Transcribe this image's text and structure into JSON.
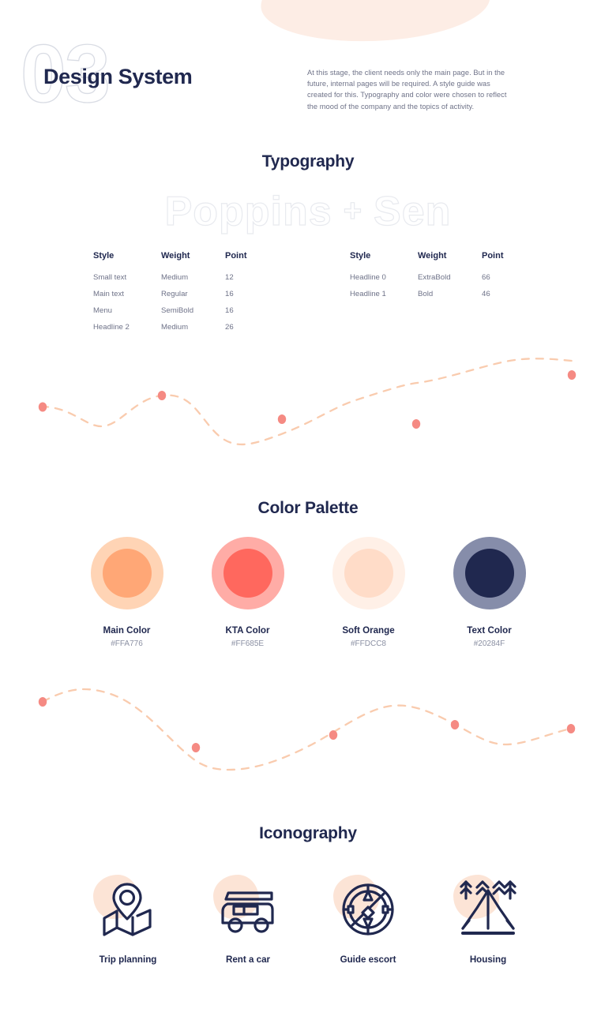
{
  "header": {
    "numeral": "03",
    "title": "Design System",
    "intro": "At this stage, the client needs only the main page. But in the future, internal pages will be required. A style guide was created for this.  Typography and color were chosen to reflect the mood of the company and the topics of activity."
  },
  "sections": {
    "typography": "Typography",
    "palette": "Color Palette",
    "iconography": "Iconography"
  },
  "typography": {
    "font_primary": "Poppins",
    "font_plus": "+",
    "font_secondary": "Sen",
    "columns": [
      "Style",
      "Weight",
      "Point"
    ],
    "left_rows": [
      {
        "style": "Small text",
        "weight": "Medium",
        "point": "12"
      },
      {
        "style": "Main text",
        "weight": "Regular",
        "point": "16"
      },
      {
        "style": "Menu",
        "weight": "SemiBold",
        "point": "16"
      },
      {
        "style": "Headline 2",
        "weight": "Medium",
        "point": "26"
      }
    ],
    "right_rows": [
      {
        "style": "Headline 0",
        "weight": "ExtraBold",
        "point": "66"
      },
      {
        "style": "Headline 1",
        "weight": "Bold",
        "point": "46"
      }
    ]
  },
  "palette": {
    "swatches": [
      {
        "name": "Main Color",
        "hex": "#FFA776",
        "ring": "#FFD4B5"
      },
      {
        "name": "KTA Color",
        "hex": "#FF685E",
        "ring": "#FFACA6"
      },
      {
        "name": "Soft Orange",
        "hex": "#FFDCC8",
        "ring": "#FFF0E7"
      },
      {
        "name": "Text Color",
        "hex": "#20284F",
        "ring": "#868DAA"
      }
    ]
  },
  "iconography": {
    "items": [
      {
        "label": "Trip planning",
        "icon": "map-pin-icon"
      },
      {
        "label": "Rent a car",
        "icon": "van-icon"
      },
      {
        "label": "Guide escort",
        "icon": "compass-icon"
      },
      {
        "label": "Housing",
        "icon": "tent-icon"
      }
    ]
  },
  "decor": {
    "wave_line_color": "#F9CBAE",
    "wave_dot_color": "#F58A83",
    "blob_color": "#FDEDE5",
    "outline_color": "#D9DCE4"
  }
}
